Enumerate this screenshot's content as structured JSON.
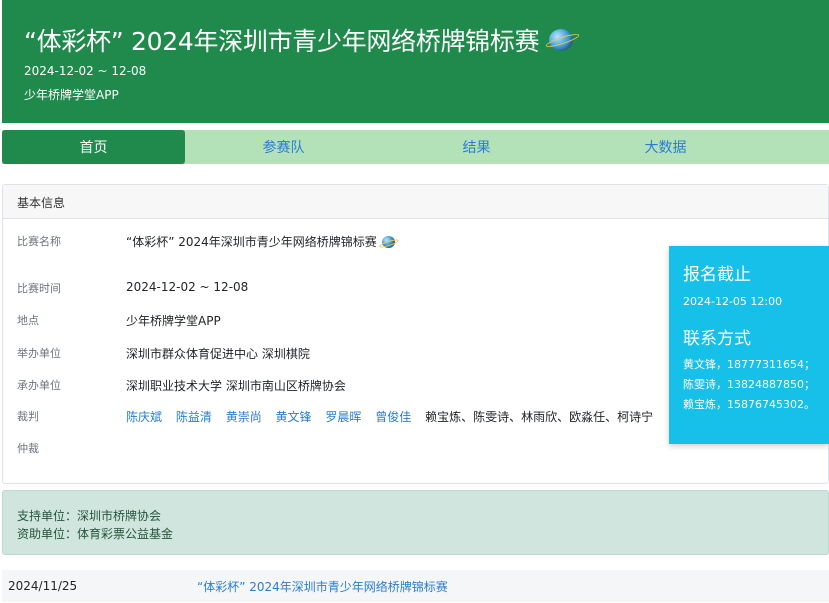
{
  "header": {
    "title": "“体彩杯” 2024年深圳市青少年网络桥牌锦标赛",
    "date": "2024-12-02 ~ 12-08",
    "venue": "少年桥牌学堂APP",
    "title_icon": "globe-icon"
  },
  "tabs": [
    {
      "label": "首页",
      "active": true
    },
    {
      "label": "参赛队",
      "active": false
    },
    {
      "label": "结果",
      "active": false
    },
    {
      "label": "大数据",
      "active": false
    }
  ],
  "basic_info": {
    "header": "基本信息",
    "rows": [
      {
        "label": "比赛名称",
        "value": "“体彩杯” 2024年深圳市青少年网络桥牌锦标赛"
      },
      {
        "label": "比赛时间",
        "value": "2024-12-02 ~ 12-08"
      },
      {
        "label": "地点",
        "value": "少年桥牌学堂APP"
      },
      {
        "label": "举办单位",
        "value": "深圳市群众体育促进中心 深圳棋院"
      },
      {
        "label": "承办单位",
        "value": "深圳职业技术大学 深圳市南山区桥牌协会"
      },
      {
        "label": "裁判",
        "value": ""
      },
      {
        "label": "仲裁",
        "value": ""
      }
    ],
    "referees_linked": [
      "陈庆斌",
      "陈益清",
      "黄崇尚",
      "黄文锋",
      "罗晨晖",
      "曾俊佳"
    ],
    "referees_plain": "赖宝炼、陈雯诗、林雨欣、欧淼任、柯诗宁"
  },
  "deadline_box": {
    "title": "报名截止",
    "date": "2024-12-05 12:00",
    "contact_title": "联系方式",
    "contacts": [
      "黄文锋，18777311654；",
      "陈雯诗，13824887850；",
      "赖宝炼，15876745302。"
    ]
  },
  "sponsors": {
    "support": "支持单位：深圳市桥牌协会",
    "funding": "资助单位：体育彩票公益基金"
  },
  "news": {
    "date": "2024/11/25",
    "title": "“体彩杯” 2024年深圳市青少年网络桥牌锦标赛"
  },
  "colors": {
    "header_bg": "#1f8a4c",
    "tabs_bg": "#b3e2b9",
    "link": "#2a7dd1",
    "deadline_bg": "#17c0e8",
    "sponsor_bg": "#cfe5dd"
  }
}
